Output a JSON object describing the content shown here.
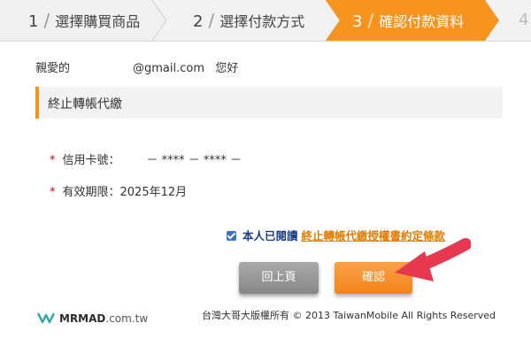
{
  "steps": [
    {
      "num": "1",
      "label": "選擇購買商品"
    },
    {
      "num": "2",
      "label": "選擇付款方式"
    },
    {
      "num": "3",
      "label": "確認付款資料"
    },
    {
      "num": "4",
      "label": ""
    }
  ],
  "colors": {
    "accent": "#f7941d",
    "active_step": "#f7941d",
    "star": "#d0021b",
    "link": "#e07b00"
  },
  "greeting": {
    "prefix": "親愛的",
    "email_suffix": "@gmail.com",
    "suffix": "您好"
  },
  "section": {
    "title": "終止轉帳代繳"
  },
  "fields": [
    {
      "label": "信用卡號：",
      "value": "－ **** － **** －"
    },
    {
      "label": "有效期限：",
      "value": "2025年12月"
    }
  ],
  "agreement": {
    "checked": true,
    "text": "本人已閱讀",
    "link_text": "終止轉帳代繳授權書約定條款"
  },
  "buttons": {
    "back": "回上頁",
    "confirm": "確認"
  },
  "footer": {
    "logo_brand": "MRMAD",
    "logo_suffix": ".com.tw",
    "copyright": "台灣大哥大版權所有 © 2013 TaiwanMobile All Rights Reserved"
  },
  "icons": {
    "annotation": "red-arrow-icon",
    "logo": "mrmad-logo-icon"
  }
}
